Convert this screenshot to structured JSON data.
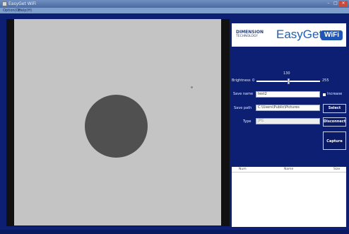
{
  "window": {
    "title": "EasyGet WiFi",
    "controls": {
      "minimize": "–",
      "maximize": "□",
      "close": "✕"
    }
  },
  "menubar": {
    "items": [
      "Option(O)",
      "Help(H)"
    ]
  },
  "logo": {
    "company_line1": "DIMENSION",
    "company_line2": "TECHNOLOGY",
    "product": "EasyGet",
    "badge": "WiFi"
  },
  "brightness": {
    "label": "Brightness",
    "min": "0",
    "max": "255",
    "value": "130",
    "fraction": 0.51
  },
  "form": {
    "save_name_label": "Save name",
    "save_name_value": "test2",
    "increase_label": "Increase",
    "save_path_label": "Save path",
    "save_path_value": "C:\\Users\\Public\\Pictures",
    "type_label": "Type",
    "type_value": "JPG"
  },
  "buttons": {
    "select": "Select",
    "disconnect": "Disconnect",
    "capture": "Capture"
  },
  "table": {
    "columns": [
      "Num",
      "Name",
      "Size"
    ],
    "rows": []
  },
  "colors": {
    "background": "#0c1f72",
    "button_bg": "#0a1a66",
    "logo_blue": "#1e5fb8",
    "video_gray": "#c4c4c4",
    "spot_gray": "#505050"
  }
}
